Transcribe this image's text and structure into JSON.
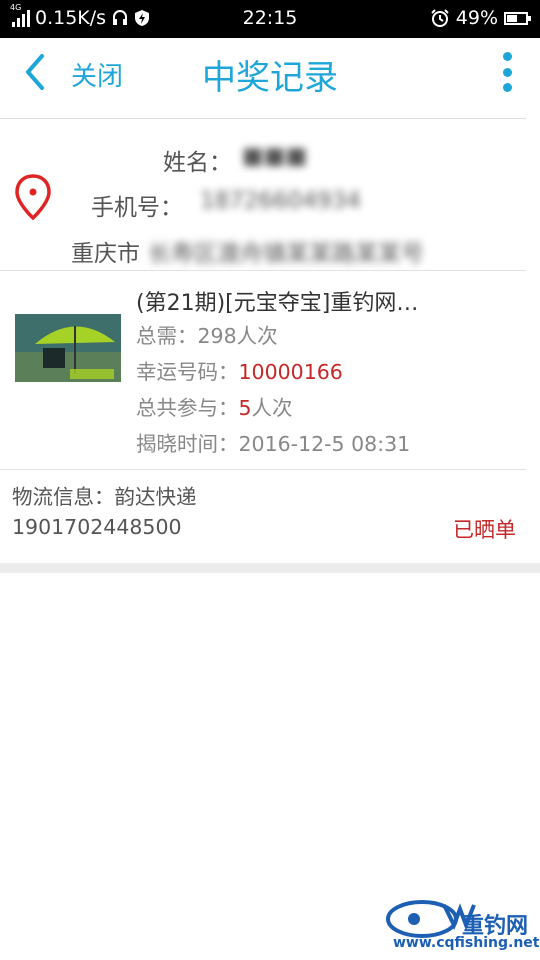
{
  "status_bar": {
    "network_type": "4G",
    "speed": "0.15K/s",
    "time": "22:15",
    "battery": "49%",
    "battery_level": 0.49
  },
  "header": {
    "close_label": "关闭",
    "title": "中奖记录",
    "accent_color": "#1fa6d9"
  },
  "address": {
    "name_label": "姓名：",
    "name_value": "■■■",
    "phone_label": "手机号：",
    "phone_value": "18726604934",
    "city": "重庆市",
    "address_value": "长寿区渡舟镇某某路某某号"
  },
  "product": {
    "title": "(第21期)[元宝夺宝]重钓网…",
    "total_need_label": "总需：",
    "total_need_value": "298人次",
    "lucky_label": "幸运号码：",
    "lucky_value": "10000166",
    "joined_label": "总共参与：",
    "joined_count": "5",
    "joined_unit": "人次",
    "reveal_label": "揭晓时间：",
    "reveal_value": "2016-12-5 08:31"
  },
  "logistics": {
    "label": "物流信息：",
    "company": "韵达快递",
    "tracking": "1901702448500",
    "status": "已晒单"
  },
  "watermark": {
    "brand": "重钓网",
    "url": "www.cqfishing.net"
  }
}
